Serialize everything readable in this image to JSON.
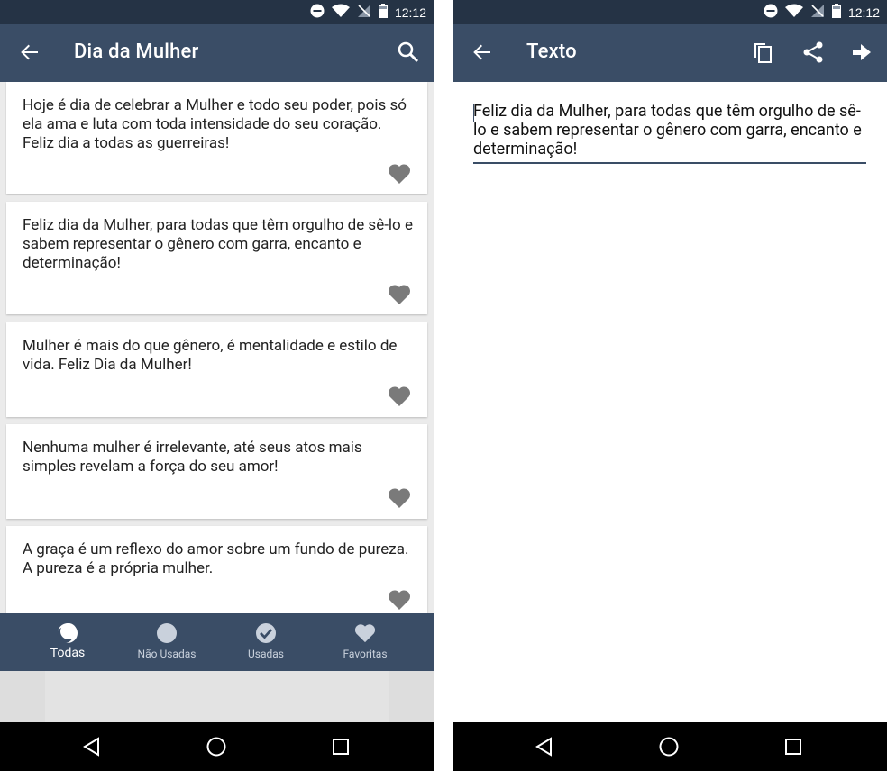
{
  "left": {
    "status_time": "12:12",
    "appbar_title": "Dia da Mulher",
    "cards": [
      {
        "text": "Hoje é dia de celebrar a Mulher e todo seu poder, pois só ela ama e luta com toda intensidade do seu coração. Feliz dia a todas as guerreiras!"
      },
      {
        "text": "Feliz dia da Mulher, para todas que têm orgulho de sê-lo e sabem representar o gênero com garra, encanto e determinação!"
      },
      {
        "text": "Mulher é mais do que gênero, é mentalidade e estilo de vida. Feliz Dia da Mulher!"
      },
      {
        "text": "Nenhuma mulher é irrelevante, até seus atos mais simples revelam a força do seu amor!"
      },
      {
        "text": "A graça é um reflexo do amor sobre um fundo de pureza. A pureza é a própria mulher."
      }
    ],
    "tabs": [
      {
        "label": "Todas",
        "icon": "half-moon-icon",
        "active": true
      },
      {
        "label": "Não Usadas",
        "icon": "circle-icon",
        "active": false
      },
      {
        "label": "Usadas",
        "icon": "check-circle-icon",
        "active": false
      },
      {
        "label": "Favoritas",
        "icon": "heart-icon",
        "active": false
      }
    ]
  },
  "right": {
    "status_time": "12:12",
    "appbar_title": "Texto",
    "editor_text": "Feliz dia da Mulher, para todas que têm orgulho de sê-lo e sabem representar o gênero com garra, encanto e determinação!"
  },
  "colors": {
    "status_bar": "#253345",
    "app_bar": "#3a4d66",
    "background": "#ebebeb",
    "heart": "#7a7a7a"
  }
}
